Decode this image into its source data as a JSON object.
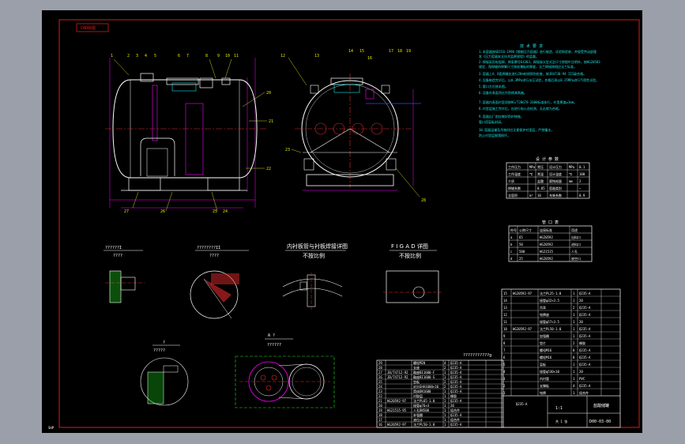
{
  "sheet": {
    "tag": "CAD绘图",
    "corner_text": "SHP",
    "drawing_number": "D00-03-00"
  },
  "colors": {
    "background": "#9a9fa9",
    "canvas": "#000000",
    "border": "#d42020",
    "outline": "#ff00ff",
    "detail": "#ffffff",
    "centerline": "#e02a2a",
    "dimension": "#19e3e3",
    "hatch": "#1fe31f",
    "leader": "#ffff33"
  },
  "callouts_front": [
    "1",
    "2",
    "3",
    "4",
    "5",
    "6",
    "7",
    "8",
    "9",
    "10",
    "11"
  ],
  "callouts_right": [
    "12",
    "13",
    "14",
    "15",
    "16",
    "17",
    "18",
    "19"
  ],
  "callouts_front_side": [
    "20",
    "21",
    "22"
  ],
  "callouts_front_bottom": [
    "27",
    "26",
    "25",
    "24"
  ],
  "callouts_side_view": [
    "23",
    "28"
  ],
  "detail_views": [
    {
      "title": "??????I",
      "subtitle": "????"
    },
    {
      "title": "????????II",
      "subtitle": "????"
    },
    {
      "title": "内衬板管与衬板焊接详图",
      "subtitle": "不按比例"
    },
    {
      "title": "F I G A D  详图",
      "subtitle": "不按比例"
    }
  ],
  "detail_lower": [
    {
      "title": "?",
      "subtitle": "?????"
    },
    {
      "title": "A  ?",
      "subtitle": "??????"
    }
  ],
  "parts_list_caption": "???????????g",
  "technical_requirements": {
    "heading": "技  术  要  求",
    "lines": [
      "1.本容器按GB150-1998《钢制压力容器》进行制造、试验和验收，并接受劳动部颁",
      "  发《压力容器安全技术监察规程》的监督。",
      "2.焊接采用电弧焊，焊条牌号E4303，焊接接头型式及尺寸除图中注明外，按HG20583",
      "  规定，角焊缝的焊脚尺寸按较薄板的厚度，法兰焊接按相应法兰标准。",
      "3.容器上A、B类焊缝应进行20%射线探伤检查，按JB4730-94 III级合格。",
      "4.设备制造完毕后，以0.3MPa进行水压试验，合格后再以0.25MPa进行气密性试验。",
      "5.管口方位按本图。",
      "6.设备外表面涂红丹防锈漆两遍。",
      "7.容器内表面衬里须按HG/T20678-2000标准执行，衬里厚度≥3mm。",
      "8.衬里层施工完毕后，应进行电火花检测，无击穿为合格。",
      "9.容器出厂前应做好防护措施，",
      "  管口用盲板封闭。",
      "10.容器运输及吊装时应注意保护衬里层，严禁撞击，",
      "  防止衬里层脱落损坏。"
    ]
  },
  "design_data": {
    "title": "设 计 参 数",
    "rows": [
      [
        "工作压力",
        "MPa",
        "常压",
        "设计压力",
        "MPa",
        "0.1"
      ],
      [
        "工作温度",
        "℃",
        "常温",
        "设计温度",
        "℃",
        "100"
      ],
      [
        "介质",
        "",
        "盐酸",
        "腐蚀裕量",
        "mm",
        "2"
      ],
      [
        "焊缝系数",
        "",
        "0.85",
        "容器类别",
        "",
        "—"
      ],
      [
        "全容积",
        "m³",
        "10",
        "充装系数",
        "",
        "0.9"
      ]
    ]
  },
  "nozzle_table": {
    "title": "管 口 表",
    "rows": [
      [
        "符号",
        "公称尺寸",
        "连接标准",
        "用途"
      ],
      [
        "a",
        "65",
        "HG20592",
        "出料口"
      ],
      [
        "b",
        "50",
        "HG20592",
        "进料口"
      ],
      [
        "c",
        "500",
        "HG21515",
        "人孔"
      ],
      [
        "d",
        "25",
        "HG20592",
        "放空口"
      ]
    ]
  },
  "parts_list_rows": [
    [
      "29",
      "",
      "螺栓M20",
      "4",
      "Q235-A",
      "",
      ""
    ],
    [
      "28",
      "",
      "支座",
      "2",
      "Q235-A",
      "",
      ""
    ],
    [
      "27",
      "JB/T4712-92",
      "鞍座BI1600-F",
      "1",
      "Q235-A",
      "",
      ""
    ],
    [
      "26",
      "JB/T4712-92",
      "鞍座BI1600-S",
      "1",
      "Q235-A",
      "",
      ""
    ],
    [
      "25",
      "",
      "垫板",
      "2",
      "Q235-A",
      "",
      ""
    ],
    [
      "24",
      "",
      "封头EHA1600×10",
      "2",
      "Q235-A",
      "",
      ""
    ],
    [
      "23",
      "",
      "筒体DN1600",
      "1",
      "Q235-A",
      "",
      ""
    ],
    [
      "22",
      "",
      "衬胶层",
      "1",
      "橡胶",
      "",
      ""
    ],
    [
      "21",
      "HG20592-97",
      "法兰PL65-1.0",
      "1",
      "Q235-A",
      "",
      ""
    ],
    [
      "20",
      "",
      "接管φ76×4",
      "1",
      "20",
      "",
      ""
    ],
    [
      "19",
      "HG21515-95",
      "人孔DN500",
      "1",
      "组合件",
      "",
      ""
    ],
    [
      "18",
      "",
      "补强圈",
      "1",
      "Q235-A",
      "",
      ""
    ],
    [
      "17",
      "",
      "液位计",
      "1",
      "组合件",
      "",
      ""
    ],
    [
      "16",
      "HG20592-97",
      "法兰PL50-1.0",
      "1",
      "Q235-A",
      "",
      ""
    ]
  ],
  "title_block_rows": [
    [
      "15",
      "HG20592-97",
      "法兰PL25-1.0",
      "1",
      "Q235-A"
    ],
    [
      "14",
      "",
      "接管φ32×3.5",
      "1",
      "20"
    ],
    [
      "13",
      "",
      "吊耳",
      "2",
      "Q235-A"
    ],
    [
      "12",
      "",
      "铭牌座",
      "1",
      "Q235-A"
    ],
    [
      "11",
      "",
      "接管φ57×3.5",
      "1",
      "20"
    ],
    [
      "10",
      "HG20592-97",
      "法兰PL50-1.0",
      "1",
      "Q235-A"
    ],
    [
      "9",
      "",
      "加强圈",
      "1",
      "Q235-A"
    ],
    [
      "8",
      "",
      "垫片",
      "2",
      "橡胶"
    ],
    [
      "7",
      "",
      "螺母M16",
      "8",
      "Q235-A"
    ],
    [
      "6",
      "",
      "螺栓M16",
      "8",
      "Q235-A"
    ],
    [
      "5",
      "",
      "盲板",
      "1",
      "Q235-A"
    ],
    [
      "4",
      "",
      "接管φ530×10",
      "1",
      "20"
    ],
    [
      "3",
      "",
      "内衬管",
      "1",
      "PVC"
    ],
    [
      "2",
      "",
      "支撑板",
      "4",
      "Q235-A"
    ],
    [
      "1",
      "",
      "铭牌",
      "1",
      "组合件"
    ]
  ],
  "title_block": {
    "company": "盐酸储罐",
    "scale": "1:1",
    "sheet": "共 1 张",
    "material": "Q235-A"
  }
}
